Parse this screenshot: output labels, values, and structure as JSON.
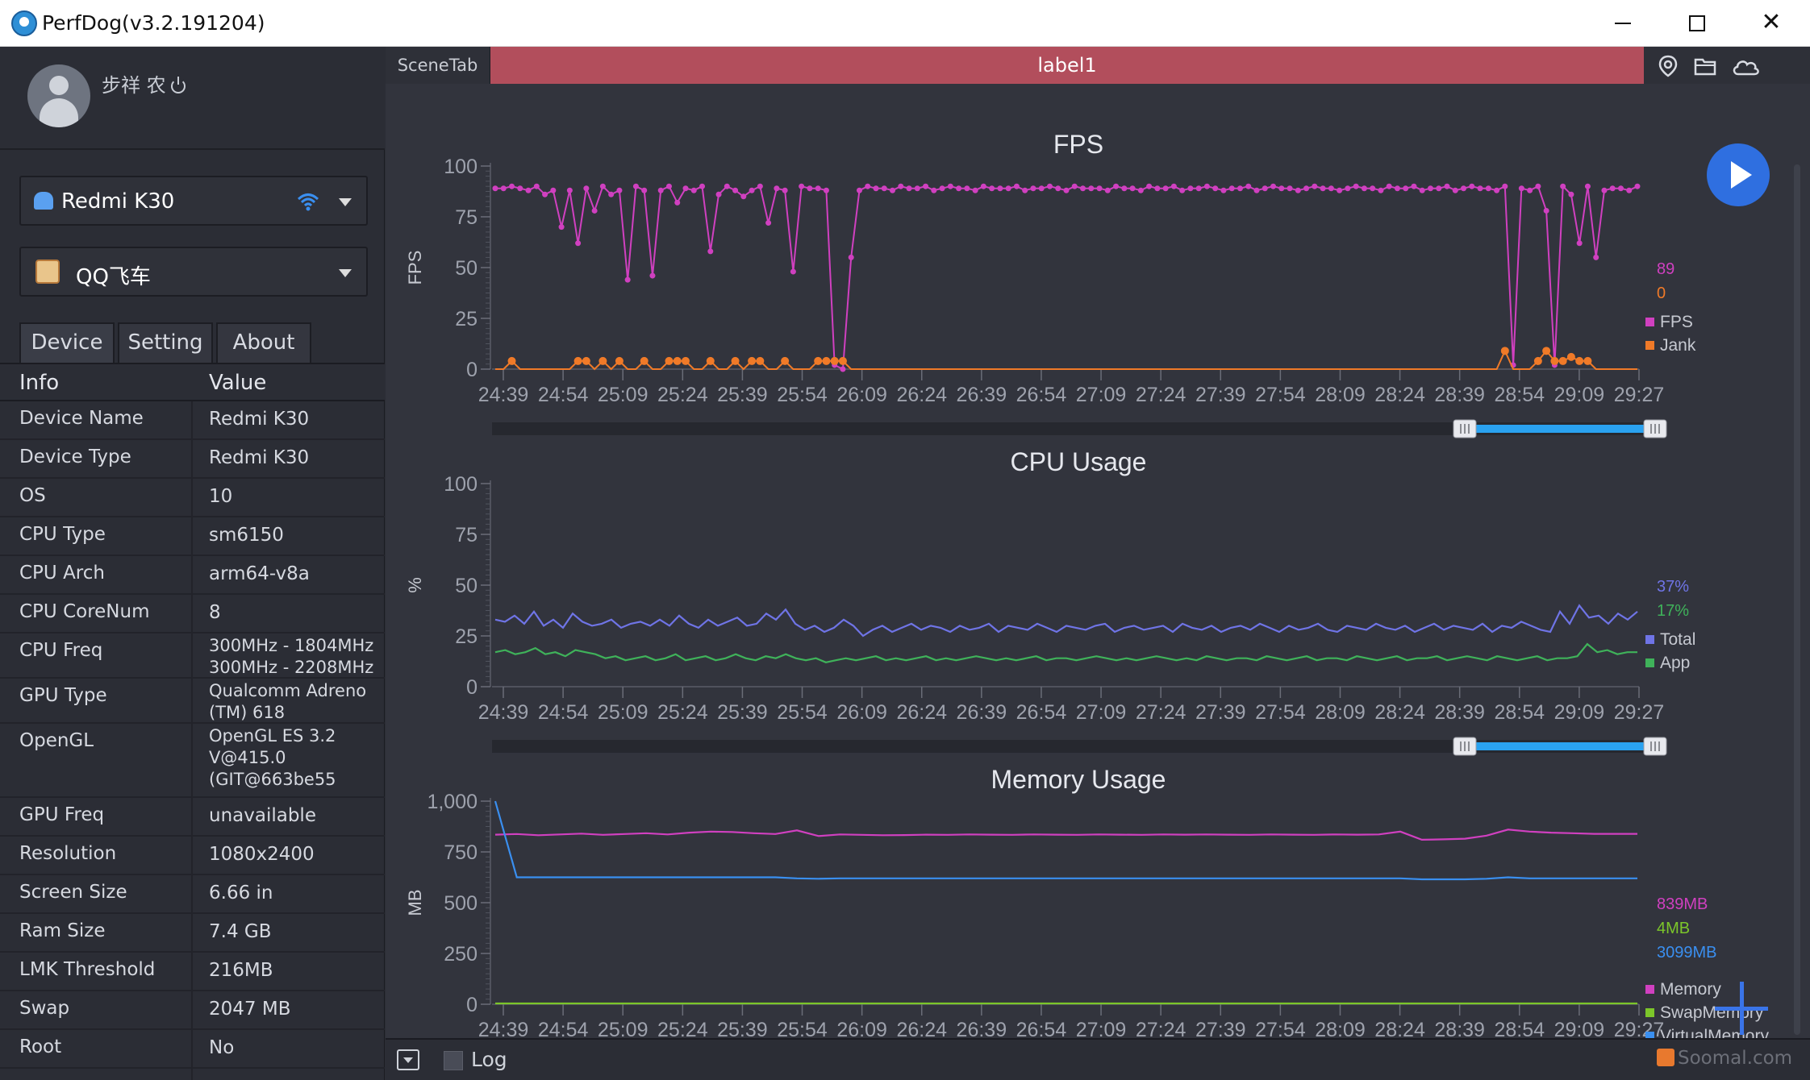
{
  "window": {
    "title": "PerfDog(v3.2.191204)"
  },
  "user": {
    "name": "步祥 农"
  },
  "device_selector": {
    "selected": "Redmi K30"
  },
  "app_selector": {
    "selected": "QQ飞车"
  },
  "sidebar_tabs": [
    "Device",
    "Setting",
    "About"
  ],
  "info_table": {
    "headers": [
      "Info",
      "Value"
    ],
    "rows": [
      {
        "key": "Device Name",
        "value": "Redmi K30"
      },
      {
        "key": "Device Type",
        "value": "Redmi K30"
      },
      {
        "key": "OS",
        "value": "10"
      },
      {
        "key": "CPU Type",
        "value": "sm6150"
      },
      {
        "key": "CPU Arch",
        "value": "arm64-v8a"
      },
      {
        "key": "CPU CoreNum",
        "value": "8"
      },
      {
        "key": "CPU Freq",
        "value": "300MHz - 1804MHz\n300MHz - 2208MHz"
      },
      {
        "key": "GPU Type",
        "value": "Qualcomm Adreno (TM) 618"
      },
      {
        "key": "OpenGL",
        "value": "OpenGL ES 3.2 V@415.0 (GIT@663be55"
      },
      {
        "key": "GPU Freq",
        "value": "unavailable"
      },
      {
        "key": "Resolution",
        "value": "1080x2400"
      },
      {
        "key": "Screen Size",
        "value": "6.66 in"
      },
      {
        "key": "Ram Size",
        "value": "7.4 GB"
      },
      {
        "key": "LMK Threshold",
        "value": "216MB"
      },
      {
        "key": "Swap",
        "value": "2047 MB"
      },
      {
        "key": "Root",
        "value": "No"
      }
    ]
  },
  "main": {
    "scene_tab": "SceneTab",
    "label": "label1",
    "log_label": "Log",
    "watermark": "Soomal.com"
  },
  "colors": {
    "fps": "#d040c0",
    "jank": "#f07a28",
    "cpu_total": "#6f74e6",
    "cpu_app": "#3fb25a",
    "memory": "#d040c0",
    "swap": "#7cc62a",
    "virtual": "#3a8ff0",
    "scene_label": "#b24e5c",
    "range_slider": "#2aa2f0"
  },
  "chart_data": [
    {
      "type": "line",
      "title": "FPS",
      "ylabel": "FPS",
      "ylim": [
        0,
        100
      ],
      "yticks": [
        "0",
        "25",
        "50",
        "75",
        "100"
      ],
      "x_ticks": [
        "24:39",
        "24:54",
        "25:09",
        "25:24",
        "25:39",
        "25:54",
        "26:09",
        "26:24",
        "26:39",
        "26:54",
        "27:09",
        "27:24",
        "27:39",
        "27:54",
        "28:09",
        "28:24",
        "28:39",
        "28:54",
        "29:09",
        "29:27"
      ],
      "current_values": [
        "89",
        "0"
      ],
      "legend": [
        "FPS",
        "Jank"
      ],
      "series": [
        {
          "name": "FPS",
          "values": [
            89,
            89,
            90,
            89,
            88,
            90,
            86,
            88,
            70,
            88,
            62,
            89,
            78,
            90,
            86,
            88,
            44,
            90,
            88,
            46,
            88,
            90,
            82,
            89,
            88,
            90,
            58,
            86,
            90,
            88,
            85,
            88,
            90,
            72,
            89,
            88,
            48,
            90,
            89,
            89,
            88,
            2,
            0,
            55,
            88,
            90,
            89,
            89,
            88,
            90,
            89,
            89,
            90,
            88,
            89,
            90,
            89,
            89,
            88,
            90,
            89,
            89,
            89,
            90,
            88,
            89,
            89,
            90,
            89,
            88,
            90,
            89,
            89,
            89,
            88,
            90,
            89,
            89,
            88,
            90,
            89,
            89,
            90,
            88,
            89,
            89,
            90,
            89,
            88,
            89,
            89,
            90,
            88,
            89,
            90,
            89,
            89,
            88,
            89,
            90,
            89,
            89,
            88,
            89,
            90,
            89,
            89,
            88,
            90,
            89,
            89,
            90,
            88,
            89,
            89,
            90,
            88,
            89,
            90,
            89,
            89,
            88,
            90,
            2,
            89,
            88,
            90,
            78,
            2,
            90,
            86,
            62,
            90,
            55,
            88,
            89,
            89,
            88,
            90
          ]
        },
        {
          "name": "Jank",
          "values": [
            0,
            0,
            4,
            0,
            0,
            0,
            0,
            0,
            0,
            0,
            4,
            4,
            0,
            4,
            0,
            4,
            0,
            0,
            4,
            0,
            0,
            4,
            4,
            4,
            0,
            0,
            4,
            0,
            0,
            4,
            0,
            4,
            4,
            0,
            0,
            4,
            0,
            0,
            0,
            4,
            4,
            4,
            4,
            0,
            0,
            0,
            0,
            0,
            0,
            0,
            0,
            0,
            0,
            0,
            0,
            0,
            0,
            0,
            0,
            0,
            0,
            0,
            0,
            0,
            0,
            0,
            0,
            0,
            0,
            0,
            0,
            0,
            0,
            0,
            0,
            0,
            0,
            0,
            0,
            0,
            0,
            0,
            0,
            0,
            0,
            0,
            0,
            0,
            0,
            0,
            0,
            0,
            0,
            0,
            0,
            0,
            0,
            0,
            0,
            0,
            0,
            0,
            0,
            0,
            0,
            0,
            0,
            0,
            0,
            0,
            0,
            0,
            0,
            0,
            0,
            0,
            0,
            0,
            0,
            0,
            0,
            0,
            9,
            0,
            0,
            0,
            4,
            9,
            4,
            4,
            6,
            4,
            4,
            0,
            0,
            0,
            0,
            0,
            0
          ]
        }
      ]
    },
    {
      "type": "line",
      "title": "CPU Usage",
      "ylabel": "%",
      "ylim": [
        0,
        100
      ],
      "yticks": [
        "0",
        "25",
        "50",
        "75",
        "100"
      ],
      "x_ticks": [
        "24:39",
        "24:54",
        "25:09",
        "25:24",
        "25:39",
        "25:54",
        "26:09",
        "26:24",
        "26:39",
        "26:54",
        "27:09",
        "27:24",
        "27:39",
        "27:54",
        "28:09",
        "28:24",
        "28:39",
        "28:54",
        "29:09",
        "29:27"
      ],
      "current_values": [
        "37%",
        "17%"
      ],
      "legend": [
        "Total",
        "App"
      ],
      "series": [
        {
          "name": "Total",
          "values": [
            33,
            32,
            35,
            31,
            37,
            30,
            33,
            29,
            36,
            32,
            30,
            31,
            33,
            29,
            31,
            32,
            30,
            33,
            30,
            35,
            31,
            29,
            33,
            30,
            32,
            34,
            30,
            31,
            36,
            33,
            38,
            31,
            28,
            30,
            27,
            29,
            33,
            30,
            25,
            28,
            30,
            27,
            29,
            31,
            28,
            30,
            29,
            27,
            30,
            28,
            29,
            31,
            27,
            30,
            29,
            28,
            31,
            29,
            27,
            30,
            29,
            28,
            30,
            31,
            27,
            29,
            30,
            28,
            29,
            30,
            27,
            31,
            29,
            28,
            30,
            27,
            29,
            30,
            28,
            31,
            29,
            27,
            30,
            28,
            29,
            31,
            28,
            27,
            30,
            29,
            28,
            31,
            29,
            28,
            30,
            27,
            29,
            31,
            28,
            30,
            29,
            28,
            31,
            27,
            30,
            29,
            32,
            30,
            28,
            27,
            37,
            31,
            40,
            34,
            35,
            31,
            36,
            33,
            37
          ]
        },
        {
          "name": "App",
          "values": [
            17,
            18,
            16,
            17,
            19,
            16,
            17,
            15,
            18,
            17,
            16,
            14,
            15,
            13,
            14,
            15,
            13,
            14,
            16,
            13,
            14,
            15,
            13,
            14,
            16,
            14,
            13,
            15,
            14,
            16,
            14,
            13,
            14,
            12,
            13,
            14,
            13,
            14,
            15,
            13,
            14,
            13,
            14,
            15,
            13,
            14,
            13,
            14,
            15,
            14,
            13,
            14,
            13,
            14,
            15,
            13,
            14,
            14,
            13,
            14,
            15,
            14,
            13,
            14,
            13,
            14,
            15,
            14,
            13,
            14,
            13,
            15,
            14,
            13,
            14,
            14,
            13,
            15,
            14,
            13,
            14,
            15,
            13,
            14,
            14,
            13,
            15,
            14,
            13,
            14,
            15,
            13,
            14,
            14,
            15,
            13,
            14,
            15,
            14,
            13,
            15,
            14,
            13,
            14,
            15,
            13,
            14,
            14,
            15,
            21,
            17,
            18,
            16,
            17,
            17
          ]
        }
      ]
    },
    {
      "type": "line",
      "title": "Memory Usage",
      "ylabel": "MB",
      "ylim": [
        0,
        1000
      ],
      "yticks": [
        "0",
        "250",
        "500",
        "750",
        "1,000"
      ],
      "x_ticks": [
        "24:39",
        "24:54",
        "25:09",
        "25:24",
        "25:39",
        "25:54",
        "26:09",
        "26:24",
        "26:39",
        "26:54",
        "27:09",
        "27:24",
        "27:39",
        "27:54",
        "28:09",
        "28:24",
        "28:39",
        "28:54",
        "29:09",
        "29:27"
      ],
      "current_values": [
        "839MB",
        "4MB",
        "3099MB"
      ],
      "legend": [
        "Memory",
        "SwapMemory",
        "VirtualMemory"
      ],
      "series": [
        {
          "name": "Memory",
          "values": [
            835,
            838,
            832,
            836,
            840,
            834,
            838,
            842,
            836,
            845,
            850,
            848,
            842,
            838,
            856,
            828,
            836,
            834,
            832,
            833,
            835,
            834,
            836,
            835,
            834,
            836,
            835,
            834,
            836,
            835,
            834,
            836,
            835,
            836,
            835,
            834,
            836,
            835,
            834,
            836,
            835,
            836,
            850,
            810,
            812,
            815,
            830,
            860,
            850,
            845,
            842,
            839,
            839,
            839
          ]
        },
        {
          "name": "SwapMemory",
          "values": [
            4,
            4,
            4,
            4,
            4,
            4,
            4,
            4,
            4,
            4,
            4,
            4,
            4,
            4,
            4,
            4,
            4,
            4,
            4,
            4,
            4,
            4,
            4,
            4,
            4,
            4,
            4,
            4,
            4,
            4,
            4,
            4,
            4,
            4,
            4,
            4,
            4,
            4,
            4,
            4,
            4,
            4,
            4,
            4,
            4,
            4,
            4,
            4,
            4,
            4,
            4,
            4,
            4,
            4
          ]
        },
        {
          "name": "VirtualMemory",
          "values": [
            1000,
            625,
            625,
            625,
            625,
            625,
            625,
            625,
            625,
            625,
            625,
            625,
            625,
            625,
            620,
            618,
            620,
            620,
            620,
            620,
            620,
            620,
            620,
            620,
            620,
            620,
            620,
            620,
            620,
            620,
            620,
            620,
            620,
            620,
            620,
            620,
            620,
            620,
            620,
            620,
            620,
            620,
            620,
            615,
            615,
            615,
            618,
            625,
            620,
            620,
            620,
            620,
            620,
            620
          ]
        }
      ]
    }
  ]
}
